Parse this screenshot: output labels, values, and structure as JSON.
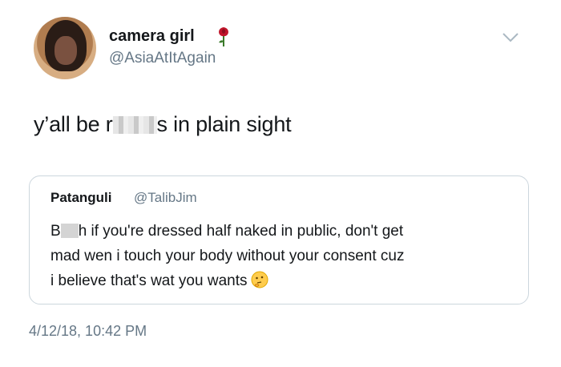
{
  "user": {
    "display_name": "camera girl",
    "handle": "@AsiaAtItAgain",
    "emoji": "rose-icon"
  },
  "tweet": {
    "text_before": "y’all be r",
    "text_after": "s in plain sight"
  },
  "quote": {
    "display_name": "Patanguli",
    "handle": "@TalibJim",
    "line1_start": "B",
    "line1_rest": "h if you're dressed half naked in public, don't get",
    "line2": "mad wen i touch your body without your consent cuz",
    "line3": "i believe that's wat you wants",
    "emoji": "thinking-face-icon"
  },
  "timestamp": "4/12/18, 10:42 PM",
  "colors": {
    "text": "#14171a",
    "secondary": "#657786",
    "border": "#ccd6dd"
  }
}
